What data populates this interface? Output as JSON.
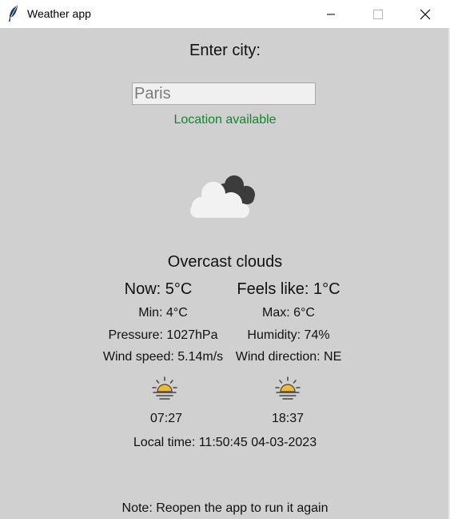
{
  "window": {
    "title": "Weather app"
  },
  "form": {
    "prompt": "Enter city:",
    "city_placeholder": "Paris",
    "status": "Location available",
    "status_color": "#0a8a28"
  },
  "weather": {
    "icon": "overcast-clouds-icon",
    "description": "Overcast clouds",
    "now": "Now: 5°C",
    "feels_like": "Feels like: 1°C",
    "min": "Min: 4°C",
    "max": "Max: 6°C",
    "pressure": "Pressure: 1027hPa",
    "humidity": "Humidity: 74%",
    "wind_speed": "Wind speed: 5.14m/s",
    "wind_direction": "Wind direction: NE"
  },
  "sun": {
    "sunrise_icon": "sunrise-icon",
    "sunrise": "07:27",
    "sunset_icon": "sunset-icon",
    "sunset": "18:37"
  },
  "local_time": "Local time: 11:50:45 04-03-2023",
  "note": "Note: Reopen the app to run it again"
}
